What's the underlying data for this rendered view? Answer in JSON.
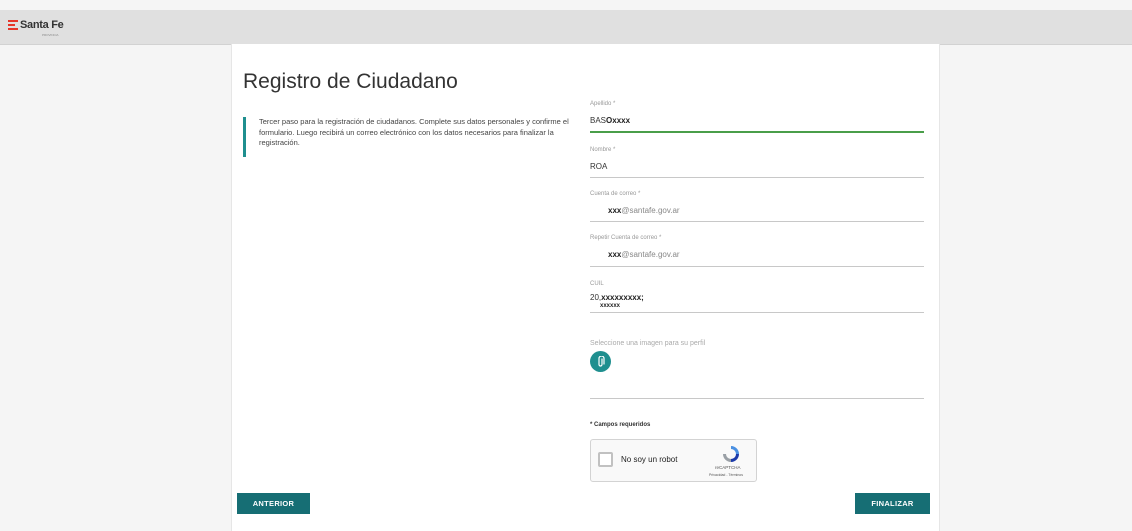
{
  "header": {
    "logo_text": "Santa Fe",
    "logo_subtext": "PROVINCIA",
    "colors": {
      "background": "#e0e0e0",
      "logo_red": "#e5372a"
    }
  },
  "page": {
    "title": "Registro de Ciudadano",
    "intro": "Tercer paso para la registración de ciudadanos. Complete sus datos personales y confirme el formulario. Luego recibirá un correo electrónico con los datos necesarios para finalizar la registración."
  },
  "form": {
    "apellido": {
      "label": "Apellido *",
      "value_prefix": "BAS",
      "value_redacted": "Oxxxx"
    },
    "nombre": {
      "label": "Nombre *",
      "value": "ROA"
    },
    "email": {
      "label": "Cuenta de correo *",
      "value_redacted": "xxx",
      "value_suffix": "@santafe.gov.ar"
    },
    "email_repeat": {
      "label": "Repetir Cuenta de correo *",
      "value_redacted": "xxx",
      "value_suffix": "@santafe.gov.ar"
    },
    "cuil": {
      "label": "CUIL",
      "value_prefix": "20,",
      "value_redacted": "xxxxxxxxx;",
      "value_line2": "xxxxxx"
    },
    "profile_image": {
      "label": "Seleccione una imagen para su perfil",
      "icon": "paperclip-icon"
    },
    "required_note": "* Campos requeridos"
  },
  "recaptcha": {
    "label": "No soy un robot",
    "brand": "reCAPTCHA",
    "terms": "Privacidad - Términos"
  },
  "buttons": {
    "previous": "ANTERIOR",
    "finish": "FINALIZAR"
  },
  "colors": {
    "accent": "#1f8f8f",
    "button": "#166e74",
    "active_underline": "#4a9e4a"
  }
}
